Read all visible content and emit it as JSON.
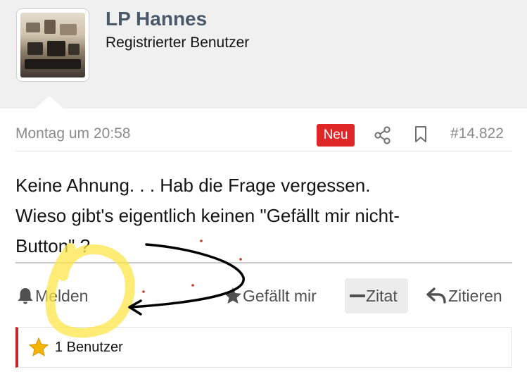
{
  "user": {
    "name": "LP Hannes",
    "title": "Registrierter Benutzer",
    "avatar_icon": "avatar-photo"
  },
  "post": {
    "date": "Montag um 20:58",
    "badge": "Neu",
    "badge_color": "#e02727",
    "number": "#14.822",
    "lines": [
      "Keine Ahnung. . . Hab die Frage vergessen.",
      "Wieso gibt's eigentlich keinen \"Gefällt mir nicht-",
      "Button\" ?"
    ]
  },
  "actions": {
    "report_label": "Melden",
    "like_label": "Gefällt mir",
    "quote_label": "Zitat",
    "reply_label": "Zitieren"
  },
  "reactions": {
    "summary": "1 Benutzer",
    "icon": "star-icon",
    "star_color": "#f4b400",
    "accent_color": "#c62828"
  },
  "annotations": {
    "highlight_color": "#fde54a",
    "arrow_color": "#000000",
    "dot_color": "#c0392b"
  }
}
